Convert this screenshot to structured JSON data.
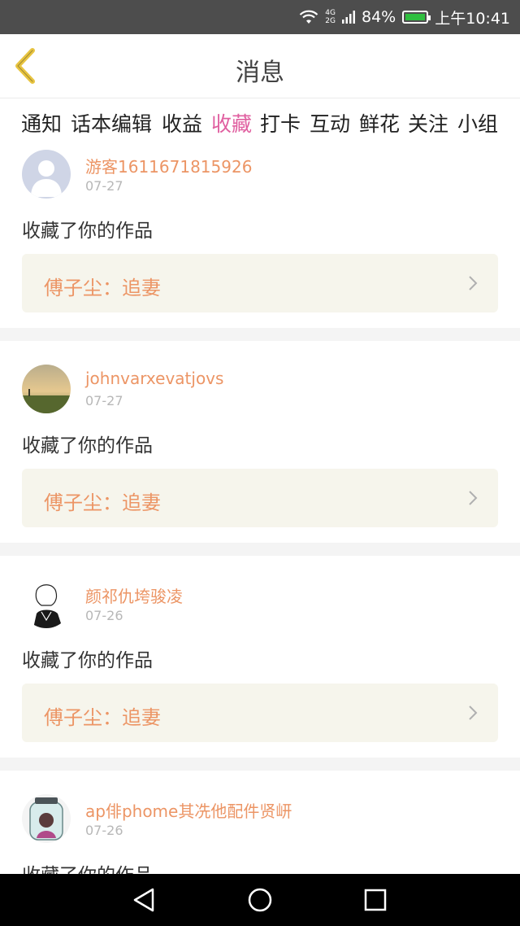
{
  "status_bar": {
    "network": [
      "4G",
      "2G"
    ],
    "battery": "84%",
    "time": "上午10:41"
  },
  "header": {
    "title": "消息",
    "back_icon": "chevron-left-icon"
  },
  "tabs": [
    {
      "label": "通知"
    },
    {
      "label": "话本编辑"
    },
    {
      "label": "收益"
    },
    {
      "label": "收藏",
      "active": true
    },
    {
      "label": "打卡"
    },
    {
      "label": "互动"
    },
    {
      "label": "鲜花"
    },
    {
      "label": "关注"
    },
    {
      "label": "小组"
    }
  ],
  "messages": [
    {
      "user": "游客1611671815926",
      "date": "07-27",
      "action": "收藏了你的作品",
      "work": "傅子尘：追妻"
    },
    {
      "user": "johnvarxevatjovs",
      "date": "07-27",
      "action": "收藏了你的作品",
      "work": "傅子尘：追妻"
    },
    {
      "user": "颜祁仇垮骏凌",
      "date": "07-26",
      "action": "收藏了你的作品",
      "work": "傅子尘：追妻"
    },
    {
      "user": "ap俳phome其冼他配件贤岍",
      "date": "07-26",
      "action": "收藏了你的作品"
    }
  ],
  "colors": {
    "accent_pink": "#e05fa0",
    "name_orange": "#ec9565",
    "card_bg": "#f6f5ec",
    "back_yellow": "#e8c440"
  }
}
